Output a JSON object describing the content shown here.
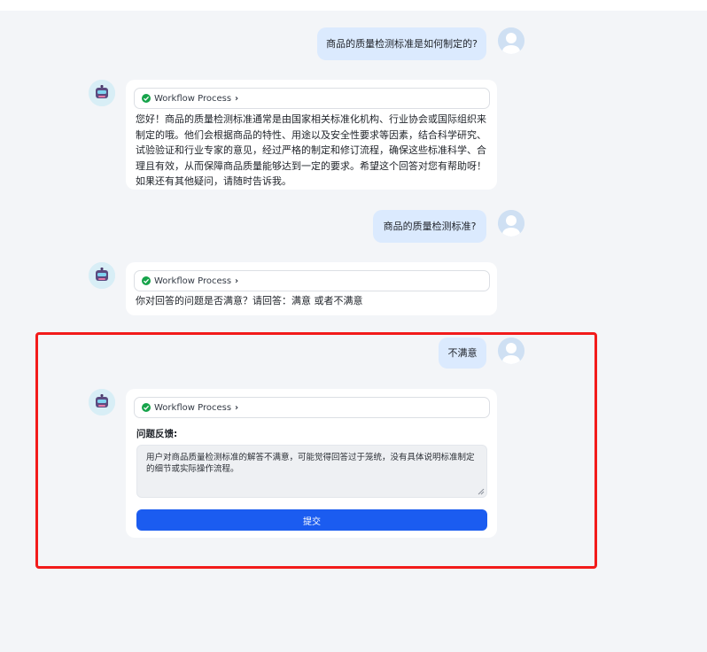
{
  "messages": [
    {
      "role": "user",
      "text": "商品的质量检测标准是如何制定的?"
    },
    {
      "role": "bot",
      "workflow_label": "Workflow Process",
      "text": "您好！商品的质量检测标准通常是由国家相关标准化机构、行业协会或国际组织来制定的哦。他们会根据商品的特性、用途以及安全性要求等因素，结合科学研究、试验验证和行业专家的意见，经过严格的制定和修订流程，确保这些标准科学、合理且有效，从而保障商品质量能够达到一定的要求。希望这个回答对您有帮助呀！如果还有其他疑问，请随时告诉我。"
    },
    {
      "role": "user",
      "text": "商品的质量检测标准?"
    },
    {
      "role": "bot",
      "workflow_label": "Workflow Process",
      "text": "你对回答的问题是否满意？请回答：满意 或者不满意"
    },
    {
      "role": "user",
      "text": "不满意"
    },
    {
      "role": "bot",
      "workflow_label": "Workflow Process"
    }
  ],
  "feedback": {
    "label": "问题反馈:",
    "value": "用户对商品质量检测标准的解答不满意，可能觉得回答过于笼统，没有具体说明标准制定的细节或实际操作流程。",
    "submit_label": "提交"
  },
  "colors": {
    "user_bubble": "#dbeafe",
    "highlight_border": "#f21b1b",
    "submit_button": "#1b5cf0",
    "success_check": "#16a34a"
  },
  "icons": [
    "user-avatar-icon",
    "bot-avatar-icon",
    "check-circle-icon",
    "chevron-right-icon",
    "resize-handle-icon"
  ]
}
